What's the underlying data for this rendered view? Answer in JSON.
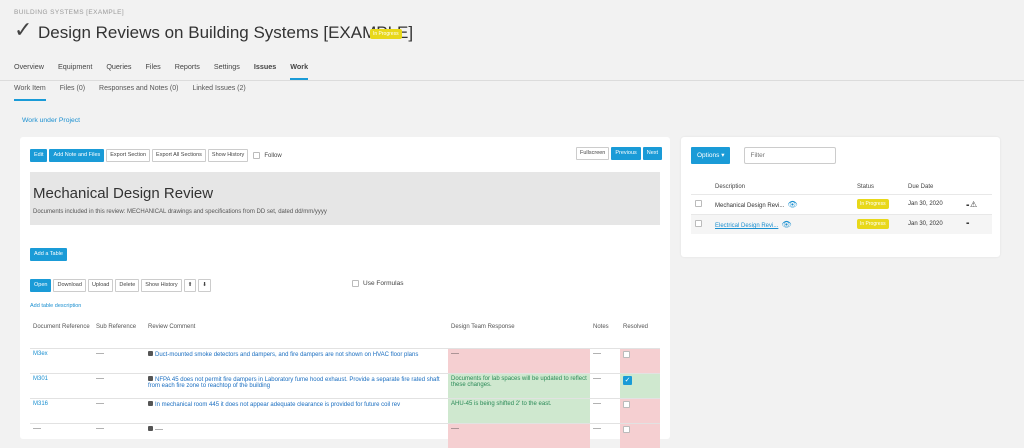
{
  "breadcrumb": "BUILDING SYSTEMS [EXAMPLE]",
  "title": "Design Reviews on Building Systems [EXAMPLE]",
  "status_badge": "In Progress",
  "tabs": [
    "Overview",
    "Equipment",
    "Queries",
    "Files",
    "Reports",
    "Settings",
    "Issues",
    "Work"
  ],
  "subtabs": [
    "Work Item",
    "Files (0)",
    "Responses and Notes (0)",
    "Linked Issues (2)"
  ],
  "work_under_project": "Work under Project",
  "toolbar": {
    "edit": "Edit",
    "add_note": "Add Note and Files",
    "export_section": "Export Section",
    "export_all": "Export All Sections",
    "show_history": "Show History",
    "follow": "Follow",
    "fullscreen": "Fullscreen",
    "previous": "Previous",
    "next": "Next"
  },
  "section": {
    "title": "Mechanical Design Review",
    "description": "Documents included in this review: MECHANICAL drawings and specifications from DD set, dated dd/mm/yyyy"
  },
  "add_table": "Add a Table",
  "table_toolbar": {
    "open": "Open",
    "download": "Download",
    "upload": "Upload",
    "delete": "Delete",
    "show_history": "Show History",
    "use_formulas": "Use Formulas"
  },
  "add_table_description": "Add table description",
  "table": {
    "headers": [
      "Document Reference",
      "Sub Reference",
      "Review Comment",
      "Design Team Response",
      "Notes",
      "Resolved"
    ],
    "rows": [
      {
        "doc": "M3ex",
        "sub": "----",
        "comment": "Duct-mounted smoke detectors and dampers, and fire dampers are not shown on HVAC floor plans",
        "response": "----",
        "notes": "----",
        "resolved": false
      },
      {
        "doc": "M301",
        "sub": "----",
        "comment": "NFPA 45 does not permit fire dampers in Laboratory fume hood exhaust. Provide a separate fire rated shaft from each fire zone to reachtop of the building",
        "response": "Documents for lab spaces will be updated to reflect these changes.",
        "notes": "----",
        "resolved": true
      },
      {
        "doc": "M316",
        "sub": "----",
        "comment": "In mechanical room 445 it does not appear adequate clearance is provided for future coil rev",
        "response": "AHU-45 is being shifted 2' to the east.",
        "notes": "----",
        "resolved": false
      },
      {
        "doc": "----",
        "sub": "----",
        "comment": "----",
        "response": "----",
        "notes": "----",
        "resolved": false
      }
    ]
  },
  "right_panel": {
    "options": "Options",
    "filter_placeholder": "Filter",
    "headers": [
      "Description",
      "Status",
      "Due Date"
    ],
    "rows": [
      {
        "description": "Mechanical Design Revi...",
        "status": "In Progress",
        "due": "Jan 30, 2020"
      },
      {
        "description": "Electrical Design Revi...",
        "status": "In Progress",
        "due": "Jan 30, 2020"
      }
    ]
  },
  "colors": {
    "accent": "#1a9bd7",
    "badge": "#e8d81a",
    "red_cell": "#f5cfd1",
    "green_cell": "#cfe8cf"
  }
}
